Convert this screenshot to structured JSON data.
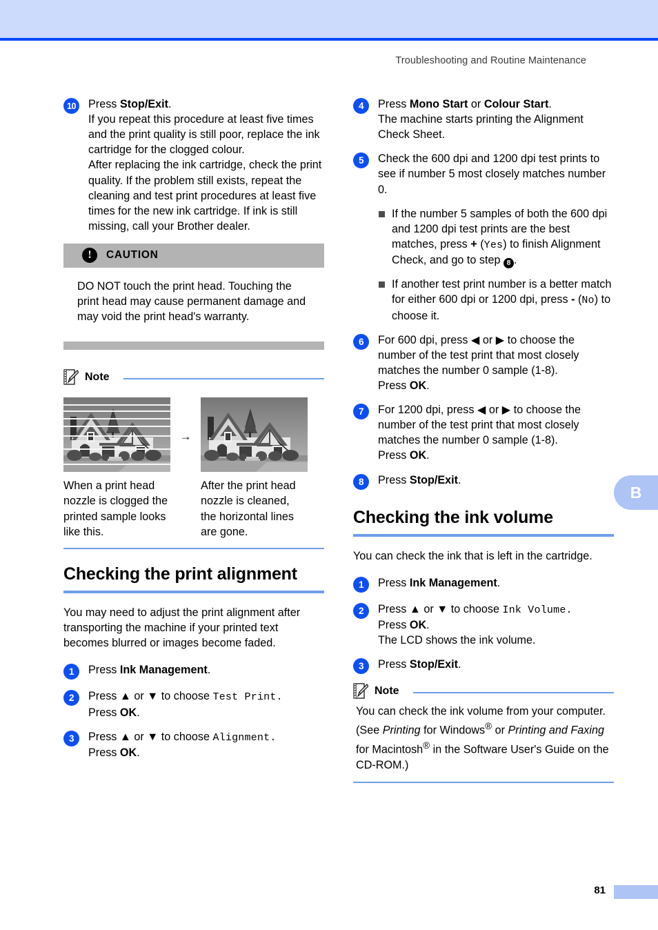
{
  "page": {
    "running_header": "Troubleshooting and Routine Maintenance",
    "page_number": "81",
    "side_tab_label": "B",
    "accent_blue": "#0249fa",
    "band_blue": "#ccdafb",
    "rule_blue": "#6f9fe8",
    "badge_blue": "#0d4ff5",
    "tab_blue": "#aec4f5",
    "caution_gray": "#b3b3b3"
  },
  "left_column": {
    "step10": {
      "number": "10",
      "line1_pre": "Press ",
      "line1_bold": "Stop/Exit",
      "line1_post": ".",
      "para1": "If you repeat this procedure at least five times and the print quality is still poor, replace the ink cartridge for the clogged colour.",
      "para2": "After replacing the ink cartridge, check the print quality. If the problem still exists, repeat the cleaning and test print procedures at least five times for the new ink cartridge. If ink is still missing, call your Brother dealer."
    },
    "caution": {
      "icon": "exclamation-icon",
      "title": "CAUTION",
      "body": "DO NOT touch the print head. Touching the print head may cause permanent damage and may void the print head's warranty."
    },
    "note": {
      "label": "Note",
      "figure_left_caption": "When a print head nozzle is clogged the printed sample looks like this.",
      "figure_arrow": "→",
      "figure_right_caption": "After the print head nozzle is cleaned, the horizontal lines are gone."
    },
    "section": {
      "heading": "Checking the print alignment",
      "intro": "You may need to adjust the print alignment after transporting the machine if your printed text becomes blurred or images become faded.",
      "steps": [
        {
          "number": "1",
          "pre": "Press ",
          "bold": "Ink Management",
          "post": "."
        },
        {
          "number": "2",
          "pre": "Press ▲ or ▼ to choose ",
          "mono": "Test Print.",
          "post": "",
          "line2_pre": "Press ",
          "line2_bold": "OK",
          "line2_post": "."
        },
        {
          "number": "3",
          "pre": "Press ▲ or ▼ to choose ",
          "mono": "Alignment.",
          "post": "",
          "line2_pre": "Press ",
          "line2_bold": "OK",
          "line2_post": "."
        }
      ]
    }
  },
  "right_column": {
    "steps": [
      {
        "number": "4",
        "line1_pre": "Press ",
        "line1_bold1": "Mono Start",
        "line1_mid": " or ",
        "line1_bold2": "Colour Start",
        "line1_post": ".",
        "para": "The machine starts printing the Alignment Check Sheet."
      },
      {
        "number": "5",
        "para": "Check the 600 dpi and 1200 dpi test prints to see if number 5 most closely matches number 0.",
        "bullets": [
          {
            "pre": "If the number 5 samples of both the 600 dpi and 1200 dpi test prints are the best matches, press ",
            "bold": "+",
            "mid": " (",
            "mono": "Yes",
            "post": ") to finish Alignment Check, and go to step ",
            "stepref": "8",
            "tail": "."
          },
          {
            "pre": "If another test print number is a better match for either 600 dpi or 1200 dpi, press ",
            "bold": "-",
            "mid": " (",
            "mono": "No",
            "post": ") to choose it.",
            "stepref": "",
            "tail": ""
          }
        ]
      },
      {
        "number": "6",
        "para": "For 600 dpi, press ◀ or ▶ to choose the number of the test print that most closely matches the number 0 sample (1-8).",
        "line2_pre": "Press ",
        "line2_bold": "OK",
        "line2_post": "."
      },
      {
        "number": "7",
        "para": "For 1200 dpi, press ◀ or ▶ to choose the number of the test print that most closely matches the number 0 sample (1-8).",
        "line2_pre": "Press ",
        "line2_bold": "OK",
        "line2_post": "."
      },
      {
        "number": "8",
        "line1_pre": "Press ",
        "line1_bold": "Stop/Exit",
        "line1_post": "."
      }
    ],
    "section": {
      "heading": "Checking the ink volume",
      "intro": "You can check the ink that is left in the cartridge.",
      "steps": [
        {
          "number": "1",
          "pre": "Press ",
          "bold": "Ink Management",
          "post": "."
        },
        {
          "number": "2",
          "pre": "Press ▲ or ▼ to choose ",
          "mono": "Ink Volume.",
          "line2_pre": "Press ",
          "line2_bold": "OK",
          "line2_post": ".",
          "line3": "The LCD shows the ink volume."
        },
        {
          "number": "3",
          "pre": "Press ",
          "bold": "Stop/Exit",
          "post": "."
        }
      ]
    },
    "note": {
      "label": "Note",
      "text_1": "You can check the ink volume from your computer. (See ",
      "italic_1": "Printing",
      "text_2": " for Windows",
      "sup_1": "®",
      "text_3": " or ",
      "italic_2": "Printing and Faxing",
      "text_4": " for Macintosh",
      "sup_2": "®",
      "text_5": " in the Software User's Guide on the CD-ROM.)"
    }
  }
}
